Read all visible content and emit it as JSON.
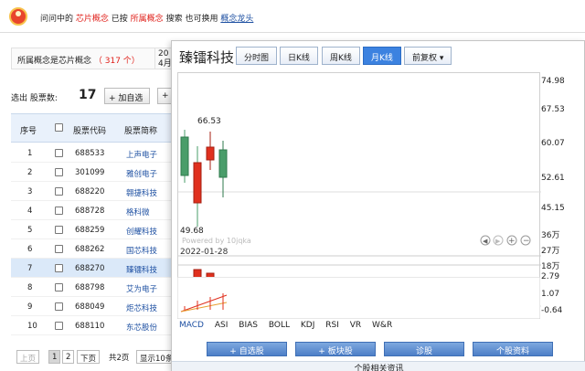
{
  "question": {
    "prefix": "问问中的",
    "term1": "芯片概念",
    "mid": "已按",
    "term2": "所属概念",
    "search": "搜索",
    "also": "也可换用",
    "alt_link": "概念龙头"
  },
  "concept_bar": {
    "label": "所属概念是芯片概念",
    "count": "（ 317 个）",
    "date_top": "20",
    "date_bottom": "4月"
  },
  "selection": {
    "label": "选出 股票数:",
    "count": "17",
    "add_button": "+ 加自选",
    "more_button": "+"
  },
  "table": {
    "headers": [
      "序号",
      "股票代码",
      "股票简称"
    ],
    "rows": [
      {
        "no": "1",
        "code": "688533",
        "name": "上声电子"
      },
      {
        "no": "2",
        "code": "301099",
        "name": "雅创电子"
      },
      {
        "no": "3",
        "code": "688220",
        "name": "翱捷科技"
      },
      {
        "no": "4",
        "code": "688728",
        "name": "格科微"
      },
      {
        "no": "5",
        "code": "688259",
        "name": "创耀科技"
      },
      {
        "no": "6",
        "code": "688262",
        "name": "国芯科技"
      },
      {
        "no": "7",
        "code": "688270",
        "name": "臻镭科技"
      },
      {
        "no": "8",
        "code": "688798",
        "name": "艾为电子"
      },
      {
        "no": "9",
        "code": "688049",
        "name": "炬芯科技"
      },
      {
        "no": "10",
        "code": "688110",
        "name": "东芯股份"
      }
    ]
  },
  "pager": {
    "prev": "上页",
    "p1": "1",
    "p2": "2",
    "next": "下页",
    "total": "共2页",
    "show": "显示10条"
  },
  "popup": {
    "stock_name": "臻镭科技",
    "tabs": [
      "分时图",
      "日K线",
      "周K线",
      "月K线",
      "前复权 ▾"
    ],
    "active_tab": "月K线",
    "chart_labels": {
      "high": "66.53",
      "low": "49.68",
      "watermark": "Powered by 10jqka",
      "date": "2022-01-28"
    },
    "price_axis": [
      "74.98",
      "67.53",
      "60.07",
      "52.61",
      "45.15"
    ],
    "volume_axis": [
      "36万",
      "27万",
      "18万"
    ],
    "macd_axis": [
      "2.79",
      "1.07",
      "-0.64"
    ],
    "indicators": [
      "MACD",
      "ASI",
      "BIAS",
      "BOLL",
      "KDJ",
      "RSI",
      "VR",
      "W&R"
    ],
    "actions": [
      "+ 自选股",
      "+ 板块股",
      "诊股",
      "个股资料"
    ],
    "footer": "个股相关资讯"
  },
  "colors": {
    "up": "#e0301e",
    "down": "#4a9d6a",
    "accent": "#3c82e0"
  }
}
